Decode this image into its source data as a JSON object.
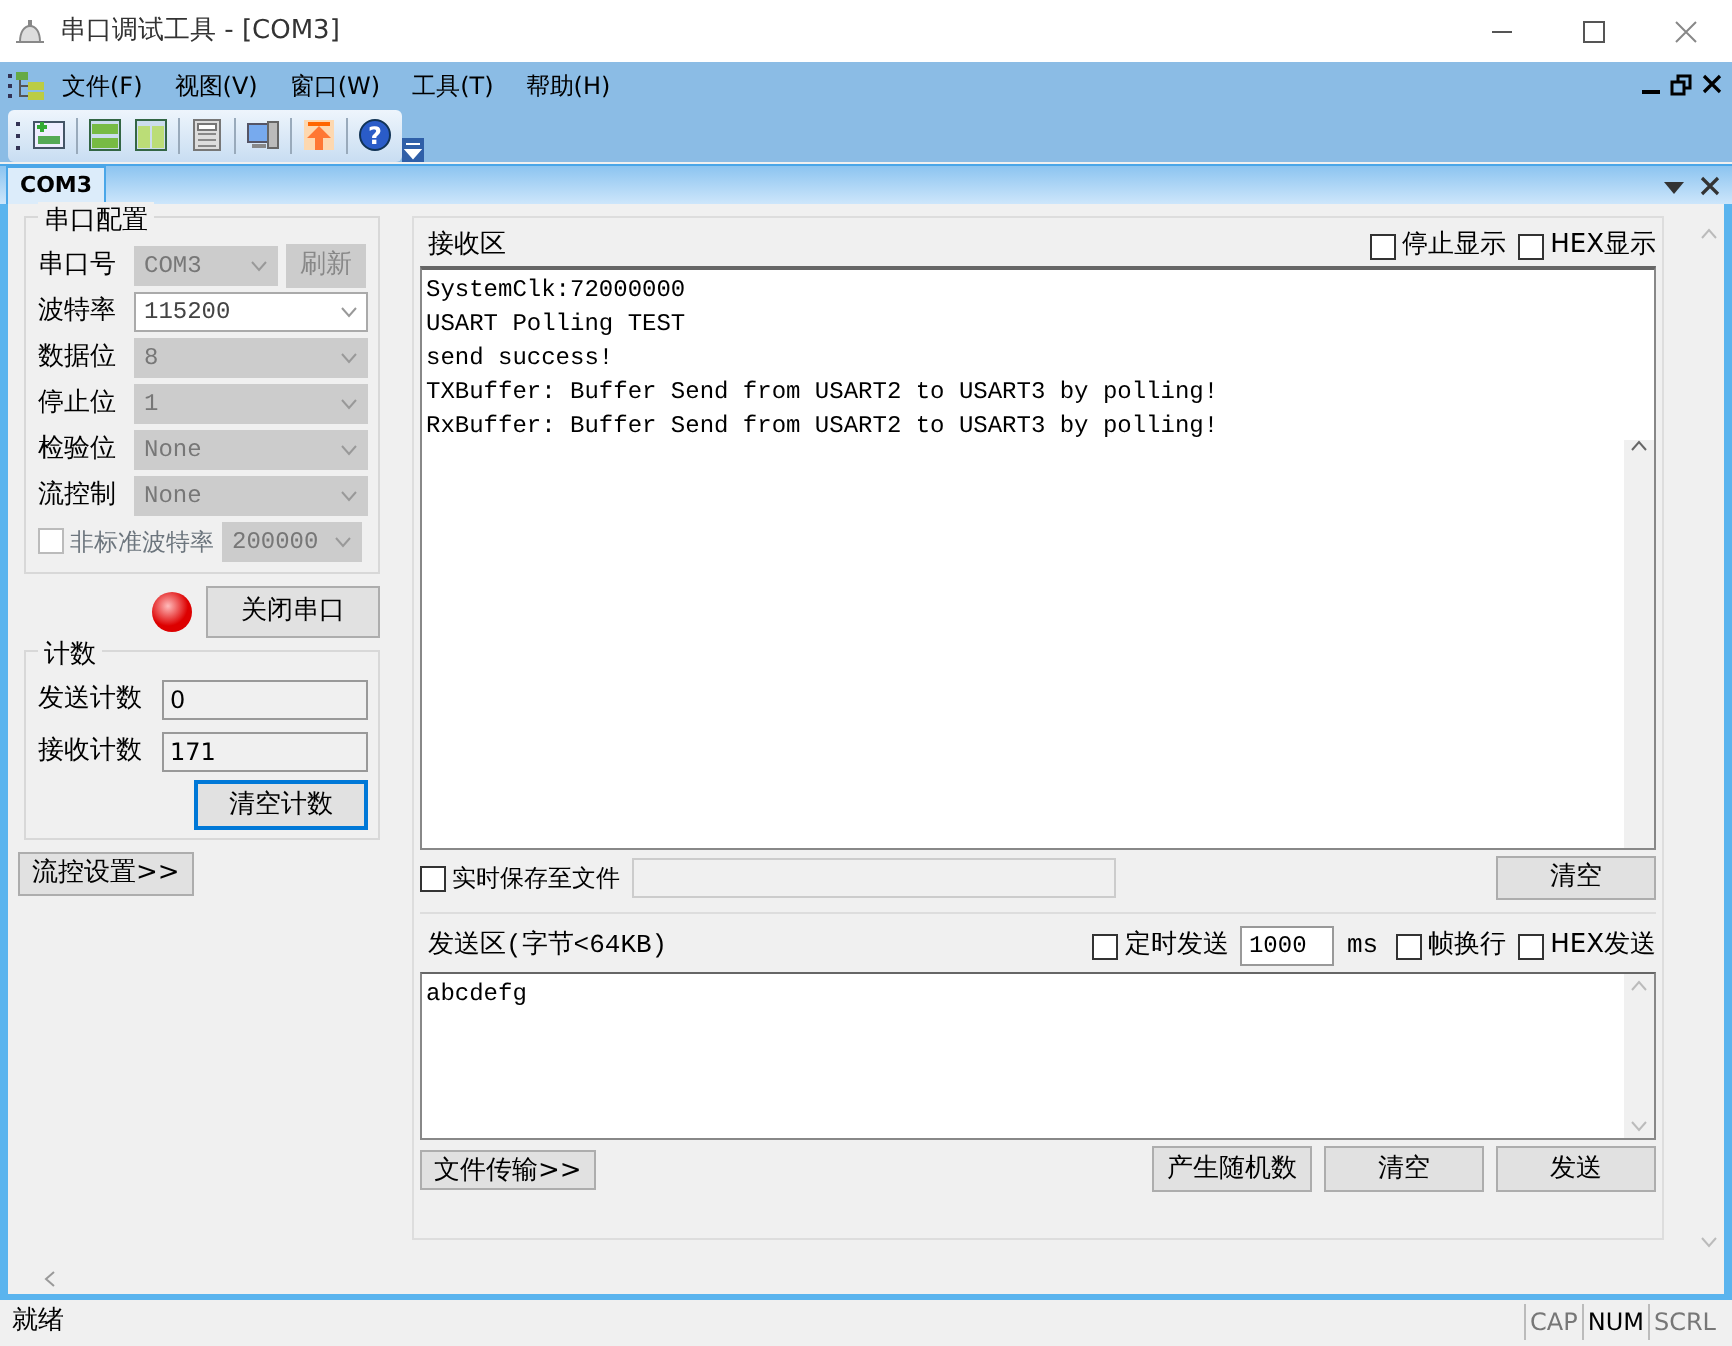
{
  "window": {
    "title": "串口调试工具 - [COM3]"
  },
  "toolbar": {
    "help_glyph": "?"
  },
  "menu": [
    "文件(F)",
    "视图(V)",
    "窗口(W)",
    "工具(T)",
    "帮助(H)"
  ],
  "tabs": [
    {
      "label": "COM3",
      "selected": true
    }
  ],
  "serial_config": {
    "title": "串口配置",
    "fields": [
      {
        "label": "串口号",
        "value": "COM3",
        "disabled": true,
        "kind": "port"
      },
      {
        "label": "波特率",
        "value": "115200",
        "disabled": false,
        "kind": "combo"
      },
      {
        "label": "数据位",
        "value": "8",
        "disabled": true,
        "kind": "combo"
      },
      {
        "label": "停止位",
        "value": "1",
        "disabled": true,
        "kind": "combo"
      },
      {
        "label": "检验位",
        "value": "None",
        "disabled": true,
        "kind": "combo"
      },
      {
        "label": "流控制",
        "value": "None",
        "disabled": true,
        "kind": "combo"
      }
    ],
    "refresh_button": "刷新",
    "nonstandard": {
      "label": "非标准波特率",
      "checked": false,
      "value": "200000"
    }
  },
  "port": {
    "button": "关闭串口",
    "open": true
  },
  "counters": {
    "title": "计数",
    "rows": [
      {
        "label": "发送计数",
        "value": "0"
      },
      {
        "label": "接收计数",
        "value": "171"
      }
    ],
    "clear_button": "清空计数"
  },
  "flow_button": "流控设置>>",
  "receive": {
    "title": "接收区",
    "options": [
      {
        "label": "停止显示",
        "checked": false
      },
      {
        "label": "HEX显示",
        "checked": false
      }
    ],
    "lines": [
      "SystemClk:72000000",
      "USART Polling TEST",
      "send success!",
      "TXBuffer: Buffer Send from USART2 to USART3 by polling!",
      "RxBuffer: Buffer Send from USART2 to USART3 by polling!"
    ],
    "save": {
      "label": "实时保存至文件",
      "checked": false
    },
    "clear_button": "清空"
  },
  "send": {
    "title": "发送区(字节<64KB)",
    "timed": {
      "label": "定时发送",
      "checked": false,
      "interval": "1000",
      "unit": "ms"
    },
    "options": [
      {
        "label": "帧换行",
        "checked": false
      },
      {
        "label": "HEX发送",
        "checked": false
      }
    ],
    "text": "abcdefg",
    "file_button": "文件传输>>",
    "buttons": [
      "产生随机数",
      "清空",
      "发送"
    ]
  },
  "status_bar": {
    "text": "就绪",
    "indicators": [
      {
        "label": "CAP",
        "on": false
      },
      {
        "label": "NUM",
        "on": true
      },
      {
        "label": "SCRL",
        "on": false
      }
    ]
  }
}
